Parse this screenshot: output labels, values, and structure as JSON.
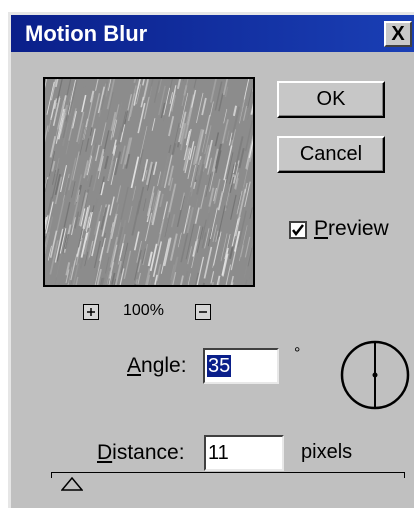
{
  "dialog": {
    "title": "Motion Blur",
    "close_symbol": "X"
  },
  "buttons": {
    "ok": "OK",
    "cancel": "Cancel"
  },
  "preview": {
    "checked": true,
    "label_accesskey": "P",
    "label_rest": "review"
  },
  "zoom": {
    "level": "100%",
    "zoom_in_icon": "plus-icon",
    "zoom_out_icon": "minus-icon"
  },
  "angle": {
    "label_accesskey": "A",
    "label_rest": "ngle:",
    "value": "35",
    "unit": "°",
    "dial_icon": "angle-dial-icon"
  },
  "distance": {
    "label_accesskey": "D",
    "label_rest": "istance:",
    "value": "11",
    "unit": "pixels"
  },
  "slider": {
    "value": 11
  },
  "colors": {
    "dialog_bg": "#c0c0c0",
    "titlebar": "#0a1f8a",
    "selection": "#0a1f8a"
  }
}
